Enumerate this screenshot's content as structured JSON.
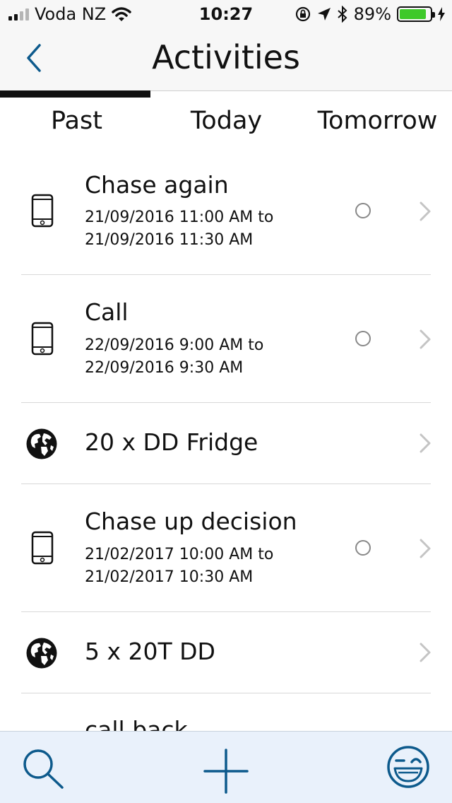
{
  "status_bar": {
    "carrier": "Voda NZ",
    "time": "10:27",
    "battery_percent_label": "89%",
    "battery_level": 0.89,
    "signal_bars": 2
  },
  "nav": {
    "title": "Activities",
    "back_icon": "chevron-left-icon"
  },
  "tabs": {
    "items": [
      "Past",
      "Today",
      "Tomorrow"
    ],
    "selected": "Past"
  },
  "activities": [
    {
      "type": "phone",
      "title": "Chase again",
      "dates": [
        "21/09/2016 11:00 AM to",
        "21/09/2016 11:30 AM"
      ],
      "has_checkbox": true
    },
    {
      "type": "phone",
      "title": "Call",
      "dates": [
        "22/09/2016 9:00 AM to",
        "22/09/2016 9:30 AM"
      ],
      "has_checkbox": true
    },
    {
      "type": "globe",
      "title": "20 x DD Fridge",
      "dates": [],
      "has_checkbox": false
    },
    {
      "type": "phone",
      "title": "Chase up decision",
      "dates": [
        "21/02/2017 10:00 AM to",
        "21/02/2017 10:30 AM"
      ],
      "has_checkbox": true
    },
    {
      "type": "globe",
      "title": "5 x 20T DD",
      "dates": [],
      "has_checkbox": false
    },
    {
      "type": "phone",
      "title": "call back",
      "dates": [],
      "has_checkbox": false
    }
  ],
  "bottom_bar": {
    "items": [
      "search-icon",
      "add-icon",
      "smiley-icon"
    ]
  },
  "colors": {
    "accent": "#0d5a8c",
    "bar_background": "#e9f1fb",
    "battery_green": "#3ec92a"
  }
}
